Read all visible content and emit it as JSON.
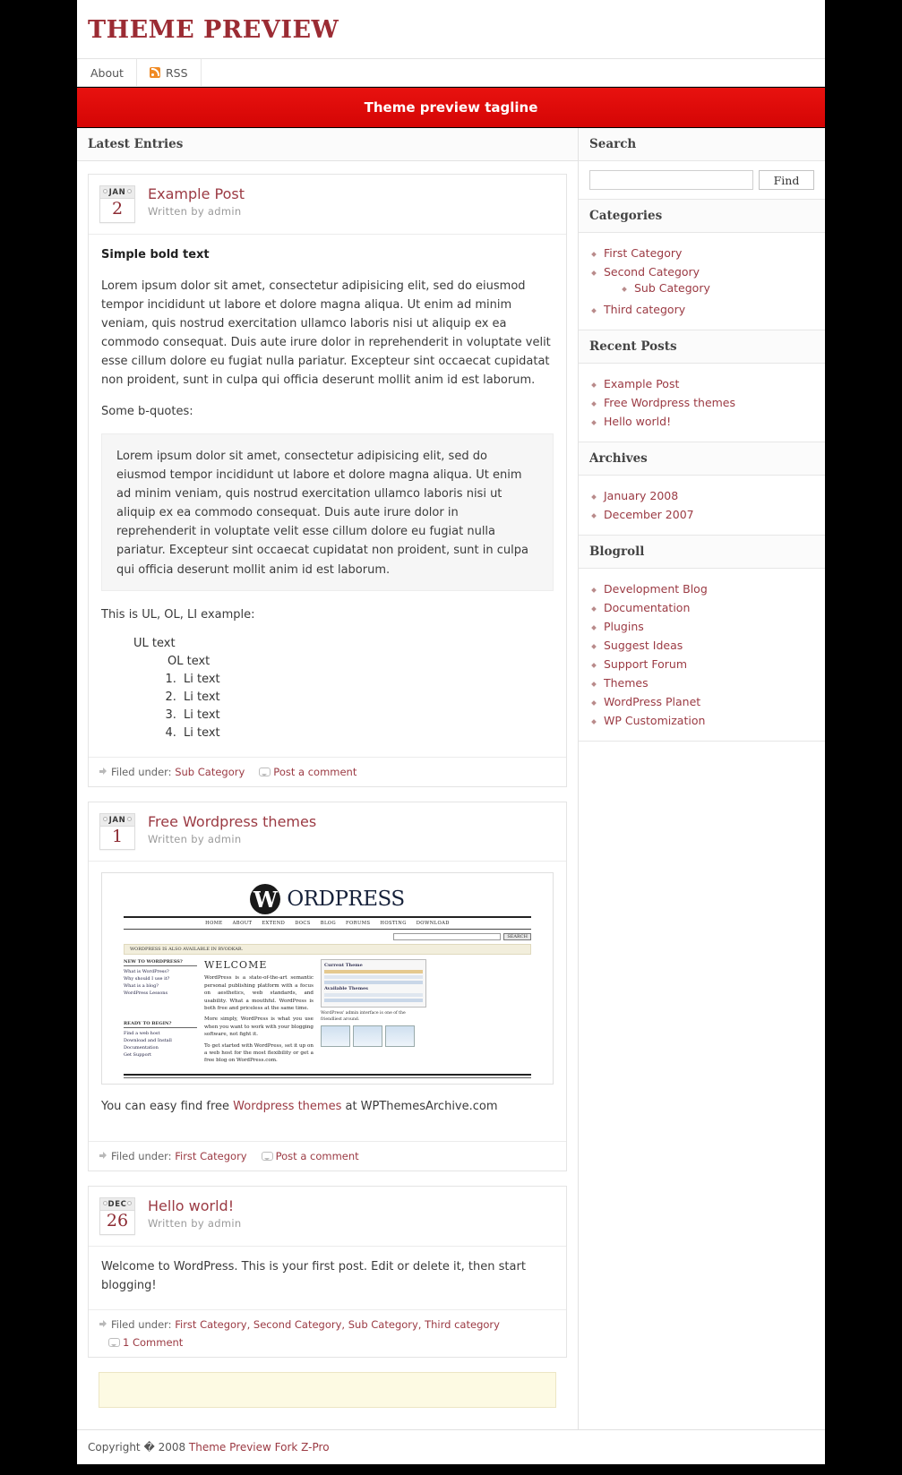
{
  "header": {
    "site_title": "Theme Preview",
    "nav": [
      {
        "label": "About",
        "icon": null
      },
      {
        "label": "RSS",
        "icon": "rss-icon"
      }
    ],
    "tagline": "Theme preview tagline"
  },
  "content": {
    "heading": "Latest Entries",
    "posts": [
      {
        "month": "JAN",
        "day": "2",
        "title": "Example Post",
        "author": "Written by admin",
        "bold_line": "Simple bold text",
        "para1": "Lorem ipsum dolor sit amet, consectetur adipisicing elit, sed do eiusmod tempor incididunt ut labore et dolore magna aliqua. Ut enim ad minim veniam, quis nostrud exercitation ullamco laboris nisi ut aliquip ex ea commodo consequat. Duis aute irure dolor in reprehenderit in voluptate velit esse cillum dolore eu fugiat nulla pariatur. Excepteur sint occaecat cupidatat non proident, sunt in culpa qui officia deserunt mollit anim id est laborum.",
        "quote_intro": "Some b-quotes:",
        "quote": "Lorem ipsum dolor sit amet, consectetur adipisicing elit, sed do eiusmod tempor incididunt ut labore et dolore magna aliqua. Ut enim ad minim veniam, quis nostrud exercitation ullamco laboris nisi ut aliquip ex ea commodo consequat. Duis aute irure dolor in reprehenderit in voluptate velit esse cillum dolore eu fugiat nulla pariatur. Excepteur sint occaecat cupidatat non proident, sunt in culpa qui officia deserunt mollit anim id est laborum.",
        "list_intro": "This is UL, OL, LI example:",
        "ul_text": "UL text",
        "ol_text": "OL text",
        "li_items": [
          "Li text",
          "Li text",
          "Li text",
          "Li text"
        ],
        "filed_label": "Filed under:",
        "categories": "Sub Category",
        "comment_label": "Post a comment"
      },
      {
        "month": "JAN",
        "day": "1",
        "title": "Free Wordpress themes",
        "author": "Written by admin",
        "caption_pre": "You can easy find free ",
        "caption_link": "Wordpress themes",
        "caption_post": " at WPThemesArchive.com",
        "filed_label": "Filed under:",
        "categories": "First Category",
        "comment_label": "Post a comment"
      },
      {
        "month": "DEC",
        "day": "26",
        "title": "Hello world!",
        "author": "Written by admin",
        "para1": "Welcome to WordPress. This is your first post. Edit or delete it, then start blogging!",
        "filed_label": "Filed under:",
        "categories": "First Category, Second Category, Sub Category, Third category",
        "comment_label": "1 Comment"
      }
    ]
  },
  "wp_shot": {
    "brand_mark": "W",
    "brand_word": "ORDPRESS",
    "nav": [
      "HOME",
      "ABOUT",
      "EXTEND",
      "DOCS",
      "BLOG",
      "FORUMS",
      "HOSTING",
      "DOWNLOAD"
    ],
    "search_button": "SEARCH",
    "notice": "WORDPRESS IS ALSO AVAILABLE IN RVODKAR.",
    "col1_head": "NEW TO WORDPRESS?",
    "col1_links": [
      "What is WordPress?",
      "Why should I use it?",
      "What is a blog?",
      "WordPress Lessons"
    ],
    "col1_head2": "READY TO BEGIN?",
    "col1_links2": [
      "Find a web host",
      "Download and Install",
      "Documentation",
      "Get Support"
    ],
    "welcome": "WELCOME",
    "para1": "WordPress is a state-of-the-art semantic personal publishing platform with a focus on aesthetics, web standards, and usability. What a mouthful. WordPress is both free and priceless at the same time.",
    "para2": "More simply, WordPress is what you use when you want to work with your blogging software, not fight it.",
    "para3": "To get started with WordPress, set it up on a web host for the most flexibility or get a free blog on WordPress.com.",
    "panel_title": "Current Theme",
    "panel_sub": "Available Themes",
    "caption": "WordPress' admin interface is one of the friendliest around."
  },
  "sidebar": {
    "search": {
      "title": "Search",
      "value": "",
      "placeholder": "",
      "button": "Find"
    },
    "widgets": [
      {
        "title": "Categories",
        "items": [
          {
            "label": "First Category",
            "children": []
          },
          {
            "label": "Second Category",
            "children": [
              {
                "label": "Sub Category"
              }
            ]
          },
          {
            "label": "Third category",
            "children": []
          }
        ]
      },
      {
        "title": "Recent Posts",
        "items": [
          {
            "label": "Example Post",
            "children": []
          },
          {
            "label": "Free Wordpress themes",
            "children": []
          },
          {
            "label": "Hello world!",
            "children": []
          }
        ]
      },
      {
        "title": "Archives",
        "items": [
          {
            "label": "January 2008",
            "children": []
          },
          {
            "label": "December 2007",
            "children": []
          }
        ]
      },
      {
        "title": "Blogroll",
        "items": [
          {
            "label": "Development Blog",
            "children": []
          },
          {
            "label": "Documentation",
            "children": []
          },
          {
            "label": "Plugins",
            "children": []
          },
          {
            "label": "Suggest Ideas",
            "children": []
          },
          {
            "label": "Support Forum",
            "children": []
          },
          {
            "label": "Themes",
            "children": []
          },
          {
            "label": "WordPress Planet",
            "children": []
          },
          {
            "label": "WP Customization",
            "children": []
          }
        ]
      }
    ]
  },
  "footer": {
    "copyright_pre": "Copyright � 2008 ",
    "copyright_link": "Theme Preview Fork Z-Pro"
  },
  "colors": {
    "accent_red": "#9b3a43",
    "tagline_red": "#e00b0b",
    "title_red": "#9b2b33"
  }
}
